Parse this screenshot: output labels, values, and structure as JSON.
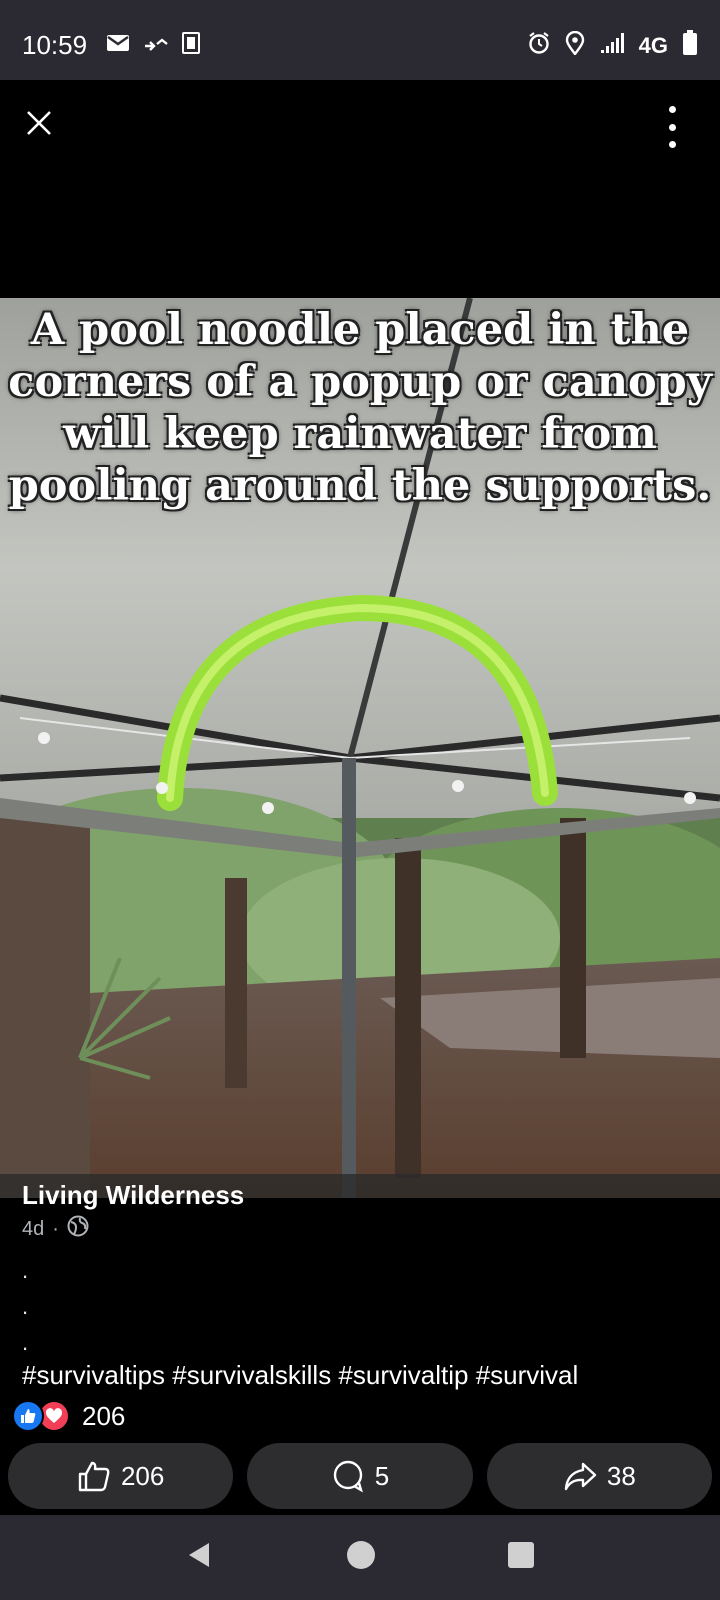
{
  "status_bar": {
    "time": "10:59",
    "network": "4G",
    "icons_left": [
      "mail-icon",
      "missed-call-icon",
      "nfc-card-icon"
    ],
    "icons_right": [
      "alarm-icon",
      "location-icon",
      "signal-icon",
      "battery-icon"
    ]
  },
  "photo": {
    "caption": "A pool noodle placed in the corners of a popup or canopy will keep rainwater from pooling around the supports."
  },
  "post": {
    "author": "Living Wilderness",
    "age": "4d",
    "separator": "·",
    "privacy_icon": "globe-icon",
    "body_lines": [
      ".",
      ".",
      "."
    ],
    "hashtags": "#survivaltips #survivalskills #survivaltip #survival",
    "reaction_count": "206"
  },
  "actions": {
    "like_count": "206",
    "comment_count": "5",
    "share_count": "38"
  },
  "colors": {
    "like_blue": "#1877f2",
    "love_red": "#f33e58",
    "bar_bg": "#2b2a33",
    "button_bg": "#2d2d2f"
  }
}
